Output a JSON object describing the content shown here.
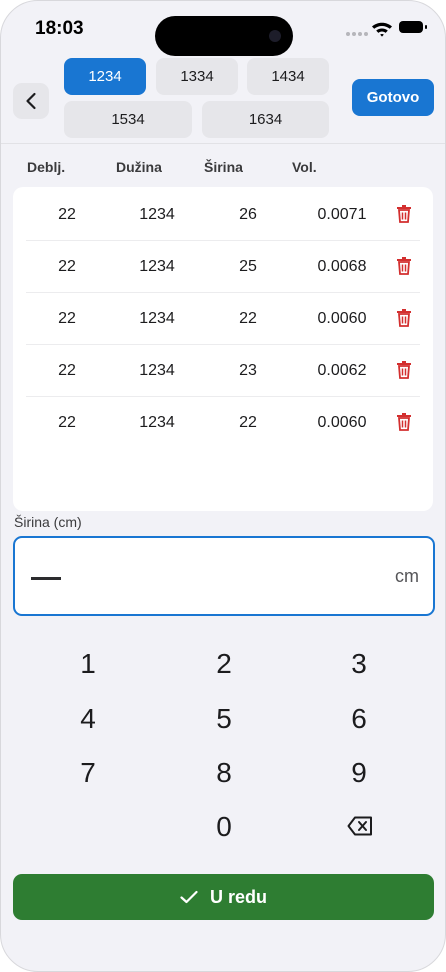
{
  "status": {
    "time": "18:03"
  },
  "chips": [
    "1234",
    "1334",
    "1434",
    "1534",
    "1634"
  ],
  "actions": {
    "done": "Gotovo",
    "confirm": "U redu"
  },
  "table": {
    "headers": [
      "Deblj.",
      "Dužina",
      "Širina",
      "Vol."
    ],
    "rows": [
      [
        "22",
        "1234",
        "26",
        "0.0071"
      ],
      [
        "22",
        "1234",
        "25",
        "0.0068"
      ],
      [
        "22",
        "1234",
        "22",
        "0.0060"
      ],
      [
        "22",
        "1234",
        "23",
        "0.0062"
      ],
      [
        "22",
        "1234",
        "22",
        "0.0060"
      ]
    ]
  },
  "input": {
    "label": "Širina (cm)",
    "unit": "cm"
  },
  "keypad": [
    "1",
    "2",
    "3",
    "4",
    "5",
    "6",
    "7",
    "8",
    "9",
    "0"
  ],
  "colors": {
    "primary": "#1976d2",
    "confirm": "#2e7d32",
    "delete": "#d32f2f"
  },
  "icons": [
    "chevron-left-icon",
    "trash-icon",
    "backspace-icon",
    "check-icon",
    "wifi-icon",
    "battery-icon"
  ]
}
